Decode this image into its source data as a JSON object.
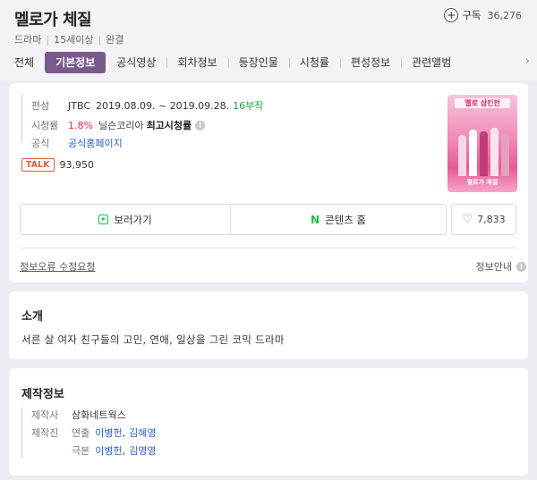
{
  "title": "멜로가 체질",
  "subscribe": {
    "label": "구독",
    "count": "36,276"
  },
  "meta": [
    "드라마",
    "15세이상",
    "완결"
  ],
  "tabs": [
    "전체",
    "기본정보",
    "공식영상",
    "회차정보",
    "등장인물",
    "시청률",
    "편성정보",
    "관련앨범"
  ],
  "active_tab": "기본정보",
  "info": {
    "broadcast_label": "편성",
    "broadcast_channel": "JTBC",
    "broadcast_period": "2019.08.09. ~ 2019.09.28.",
    "broadcast_episodes": "16부작",
    "rating_label": "시청률",
    "rating_value": "1.8%",
    "rating_region": "닐슨코리아",
    "rating_type": "최고시청률",
    "official_label": "공식",
    "official_link": "공식홈페이지"
  },
  "talk": {
    "badge": "TALK",
    "count": "93,950"
  },
  "poster": {
    "title_text": "멜로 삼킨전",
    "logo_text": "멜로가 체질"
  },
  "buttons": {
    "watch": "보러가기",
    "home": "콘텐츠 홈",
    "like_count": "7,833"
  },
  "footer": {
    "report": "정보오류 수정요청",
    "guide": "정보안내"
  },
  "intro": {
    "title": "소개",
    "text": "서른 살 여자 친구들의 고민, 연애, 일상을 그린 코믹 드라마"
  },
  "production": {
    "title": "제작정보",
    "company_label": "제작사",
    "company": "삼화네트웍스",
    "staff_label": "제작진",
    "director_label": "연출",
    "directors": [
      "이병헌",
      "김혜영"
    ],
    "writer_label": "극본",
    "writers": [
      "이병헌",
      "김영영"
    ]
  },
  "colors": {
    "tab_active": "#7a5a8c",
    "link": "#2d5fc4",
    "green": "#19a53b",
    "red": "#e3294c",
    "talk": "#e35b3e"
  }
}
